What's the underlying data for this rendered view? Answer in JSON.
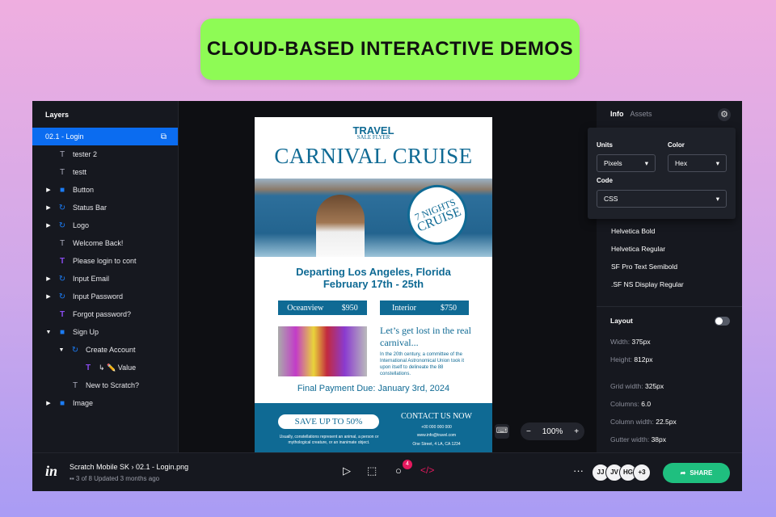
{
  "banner": "CLOUD-BASED INTERACTIVE DEMOS",
  "layers": {
    "title": "Layers",
    "items": [
      {
        "label": "02.1 - Login",
        "icon": "artboard",
        "selected": true
      },
      {
        "label": "tester 2",
        "icon": "text"
      },
      {
        "label": "testt",
        "icon": "text"
      },
      {
        "label": "Button",
        "icon": "folder",
        "expand": "▶"
      },
      {
        "label": "Status Bar",
        "icon": "component",
        "expand": "▶"
      },
      {
        "label": "Logo",
        "icon": "component",
        "expand": "▶"
      },
      {
        "label": "Welcome Back!",
        "icon": "text"
      },
      {
        "label": "Please login to cont",
        "icon": "text-purple"
      },
      {
        "label": "Input Email",
        "icon": "component",
        "expand": "▶"
      },
      {
        "label": "Input Password",
        "icon": "component",
        "expand": "▶"
      },
      {
        "label": "Forgot password?",
        "icon": "text-purple"
      },
      {
        "label": "Sign Up",
        "icon": "folder",
        "expand": "▼"
      },
      {
        "label": "Create Account",
        "icon": "component",
        "expand": "▼"
      },
      {
        "label": "↳ ✏️ Value",
        "icon": "text-purple"
      },
      {
        "label": "New to Scratch?",
        "icon": "text"
      },
      {
        "label": "Image",
        "icon": "folder",
        "expand": "▶"
      }
    ]
  },
  "flyer": {
    "t1": "TRAVEL",
    "t2": "SALE FLYER",
    "headline": "CARNIVAL CRUISE",
    "badge1": "7 NIGHTS",
    "badge2": "CRUISE",
    "dep1": "Departing Los Angeles, Florida",
    "dep2": "February 17th - 25th",
    "p1_label": "Oceanview",
    "p1_price": "$950",
    "p2_label": "Interior",
    "p2_price": "$750",
    "lets": "Let’s get lost in the real carnival...",
    "para": "In the 20th century, a committee of the International Astronomical Union took it upon itself to delineate the 88 constellations.",
    "final": "Final Payment Due: January 3rd, 2024",
    "save": "SAVE UP TO 50%",
    "small": "Usually, constellations represent an animal, a person or mythological creature, or an inanimate object.",
    "contact": "CONTACT US NOW",
    "phone": "+00 000 000 000",
    "email": "www.info@travel.com",
    "address": "One Street, 4 LA, CA 1234"
  },
  "zoom": {
    "minus": "−",
    "level": "100%",
    "plus": "+"
  },
  "right": {
    "tabs": [
      "Info",
      "Assets"
    ],
    "units_label": "Units",
    "units": "Pixels",
    "color_label": "Color",
    "color": "Hex",
    "code_label": "Code",
    "code": "CSS",
    "fonts": [
      "Helvetica Bold",
      "Helvetica Regular",
      "SF Pro Text Semibold",
      ".SF NS Display Regular"
    ],
    "layout_label": "Layout",
    "layout_toggle": false,
    "props": [
      {
        "k": "Width:",
        "v": "375px"
      },
      {
        "k": "Height:",
        "v": "812px"
      },
      {
        "k": "Grid width:",
        "v": "325px"
      },
      {
        "k": "Columns:",
        "v": "6.0"
      },
      {
        "k": "Column width:",
        "v": "22.5px"
      },
      {
        "k": "Gutter width:",
        "v": "38px"
      }
    ]
  },
  "bottom": {
    "logo": "in",
    "title": "Scratch Mobile SK › 02.1 - Login.png",
    "sub": "3 of 8   Updated 3 months ago",
    "comments": "4",
    "more": "···",
    "avatars": [
      "JJ",
      "JV",
      "HG",
      "+3"
    ],
    "share": "SHARE"
  }
}
